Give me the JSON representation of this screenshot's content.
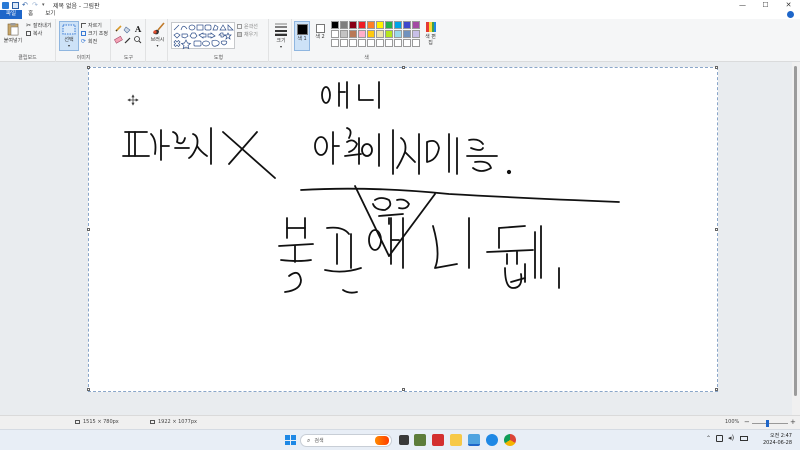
{
  "window": {
    "title": "제목 없음 - 그림판",
    "controls": [
      "minimize",
      "maximize",
      "close"
    ]
  },
  "tabs": [
    {
      "label": "파일",
      "active": true
    },
    {
      "label": "홈",
      "active": false
    },
    {
      "label": "보기",
      "active": false
    }
  ],
  "ribbon": {
    "clipboard": {
      "paste_label": "붙여넣기",
      "cut_label": "잘라내기",
      "copy_label": "복사",
      "group_label": "클립보드"
    },
    "image": {
      "select_label": "선택",
      "crop_label": "자르기",
      "resize_label": "크기 조정",
      "rotate_label": "회전",
      "group_label": "이미지"
    },
    "tools": {
      "group_label": "도구"
    },
    "brush": {
      "label": "브러시"
    },
    "shapes": {
      "outline_label": "윤곽선",
      "fill_label": "채우기",
      "group_label": "도형"
    },
    "size": {
      "label": "크기"
    },
    "colors": {
      "color1_label": "색 1",
      "color2_label": "색 2",
      "edit_label": "색 편집",
      "group_label": "색",
      "palette_row1": [
        "#000000",
        "#7f7f7f",
        "#880015",
        "#ed1c24",
        "#ff7f27",
        "#fff200",
        "#22b14c",
        "#00a2e8",
        "#3f48cc",
        "#a349a4"
      ],
      "palette_row2": [
        "#ffffff",
        "#c3c3c3",
        "#b97a57",
        "#ffaec9",
        "#ffc90e",
        "#efe4b0",
        "#b5e61d",
        "#99d9ea",
        "#7092be",
        "#c8bfe7"
      ],
      "palette_row3": [
        "#ffffff",
        "#ffffff",
        "#ffffff",
        "#ffffff",
        "#ffffff",
        "#ffffff",
        "#ffffff",
        "#ffffff",
        "#ffffff",
        "#ffffff"
      ]
    }
  },
  "status": {
    "selection_size": "1515 × 780px",
    "canvas_size": "1922 × 1077px",
    "zoom": "100%"
  },
  "taskbar": {
    "search_placeholder": "검색",
    "time": "오전 2:47",
    "date": "2024-06-28"
  }
}
